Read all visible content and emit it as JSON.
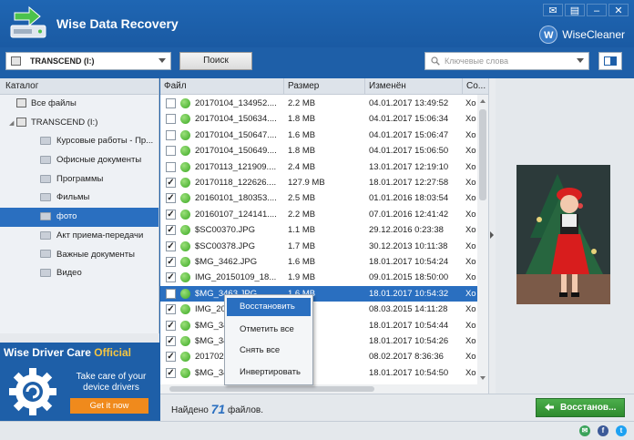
{
  "app": {
    "title": "Wise Data Recovery",
    "brand_initial": "W",
    "brand_name": "WiseCleaner"
  },
  "window_controls": [
    "✉",
    "▤",
    "–",
    "✕"
  ],
  "toolbar": {
    "drive": "TRANSCEND (I:)",
    "search_label": "Поиск",
    "keyword_placeholder": "Ключевые слова"
  },
  "sidebar": {
    "header": "Каталог",
    "items": [
      {
        "label": "Все файлы",
        "level": 1,
        "icon": "drive-icon"
      },
      {
        "label": "TRANSCEND (I:)",
        "level": 1,
        "icon": "drive-icon",
        "expander": "◢"
      },
      {
        "label": "Курсовые работы - Пр...",
        "level": 2,
        "icon": "folder-icon"
      },
      {
        "label": "Офисные документы",
        "level": 2,
        "icon": "folder-icon"
      },
      {
        "label": "Программы",
        "level": 2,
        "icon": "folder-icon"
      },
      {
        "label": "Фильмы",
        "level": 2,
        "icon": "folder-icon"
      },
      {
        "label": "фото",
        "level": 2,
        "icon": "folder-icon",
        "selected": true
      },
      {
        "label": "Акт приема-передачи",
        "level": 2,
        "icon": "folder-icon"
      },
      {
        "label": "Важные документы",
        "level": 2,
        "icon": "folder-icon"
      },
      {
        "label": "Видео",
        "level": 2,
        "icon": "folder-icon"
      }
    ]
  },
  "promo": {
    "title_main": "Wise Driver Care ",
    "title_accent": "Official",
    "text": "Take care of your device drivers",
    "button": "Get it now"
  },
  "file_table": {
    "columns": [
      "Файл",
      "Размер",
      "Изменён",
      "Со..."
    ],
    "rows": [
      {
        "checked": false,
        "name": "20170104_134952....",
        "size": "2.2 MB",
        "date": "04.01.2017 13:49:52",
        "state": "Хо"
      },
      {
        "checked": false,
        "name": "20170104_150634....",
        "size": "1.8 MB",
        "date": "04.01.2017 15:06:34",
        "state": "Хо"
      },
      {
        "checked": false,
        "name": "20170104_150647....",
        "size": "1.6 MB",
        "date": "04.01.2017 15:06:47",
        "state": "Хо"
      },
      {
        "checked": false,
        "name": "20170104_150649....",
        "size": "1.8 MB",
        "date": "04.01.2017 15:06:50",
        "state": "Хо"
      },
      {
        "checked": false,
        "name": "20170113_121909....",
        "size": "2.4 MB",
        "date": "13.01.2017 12:19:10",
        "state": "Хо"
      },
      {
        "checked": true,
        "name": "20170118_122626....",
        "size": "127.9 MB",
        "date": "18.01.2017 12:27:58",
        "state": "Хо"
      },
      {
        "checked": true,
        "name": "20160101_180353....",
        "size": "2.5 MB",
        "date": "01.01.2016 18:03:54",
        "state": "Хо"
      },
      {
        "checked": true,
        "name": "20160107_124141....",
        "size": "2.2 MB",
        "date": "07.01.2016 12:41:42",
        "state": "Хо"
      },
      {
        "checked": true,
        "name": "$SC00370.JPG",
        "size": "1.1 MB",
        "date": "29.12.2016 0:23:38",
        "state": "Хо"
      },
      {
        "checked": true,
        "name": "$SC00378.JPG",
        "size": "1.7 MB",
        "date": "30.12.2013 10:11:38",
        "state": "Хо"
      },
      {
        "checked": true,
        "name": "$MG_3462.JPG",
        "size": "1.6 MB",
        "date": "18.01.2017 10:54:24",
        "state": "Хо"
      },
      {
        "checked": true,
        "name": "IMG_20150109_18...",
        "size": "1.9 MB",
        "date": "09.01.2015 18:50:00",
        "state": "Хо"
      },
      {
        "checked": false,
        "name": "$MG_3463.JPG",
        "size": "1.6 MB",
        "date": "18.01.2017 10:54:32",
        "state": "Хо",
        "selected": true
      },
      {
        "checked": true,
        "name": "IMG_20...",
        "size": "",
        "date": "08.03.2015 14:11:28",
        "state": "Хо"
      },
      {
        "checked": true,
        "name": "$MG_34...",
        "size": "",
        "date": "18.01.2017 10:54:44",
        "state": "Хо"
      },
      {
        "checked": true,
        "name": "$MG_34...",
        "size": "",
        "date": "18.01.2017 10:54:26",
        "state": "Хо"
      },
      {
        "checked": true,
        "name": "201702...",
        "size": "",
        "date": "08.02.2017 8:36:36",
        "state": "Хо"
      },
      {
        "checked": true,
        "name": "$MG_34...",
        "size": "",
        "date": "18.01.2017 10:54:50",
        "state": "Хо"
      }
    ]
  },
  "context_menu": {
    "items": [
      "Восстановить",
      "Отметить все",
      "Снять все",
      "Инвертировать"
    ]
  },
  "status": {
    "found_prefix": "Найдено",
    "found_count": "71",
    "found_suffix": "файлов.",
    "restore_label": "Восстанов..."
  },
  "colors": {
    "accent": "#1e5fa8",
    "selection": "#2a6fc0",
    "restore_green": "#3a9d3a",
    "promo_button": "#f08a1c"
  }
}
